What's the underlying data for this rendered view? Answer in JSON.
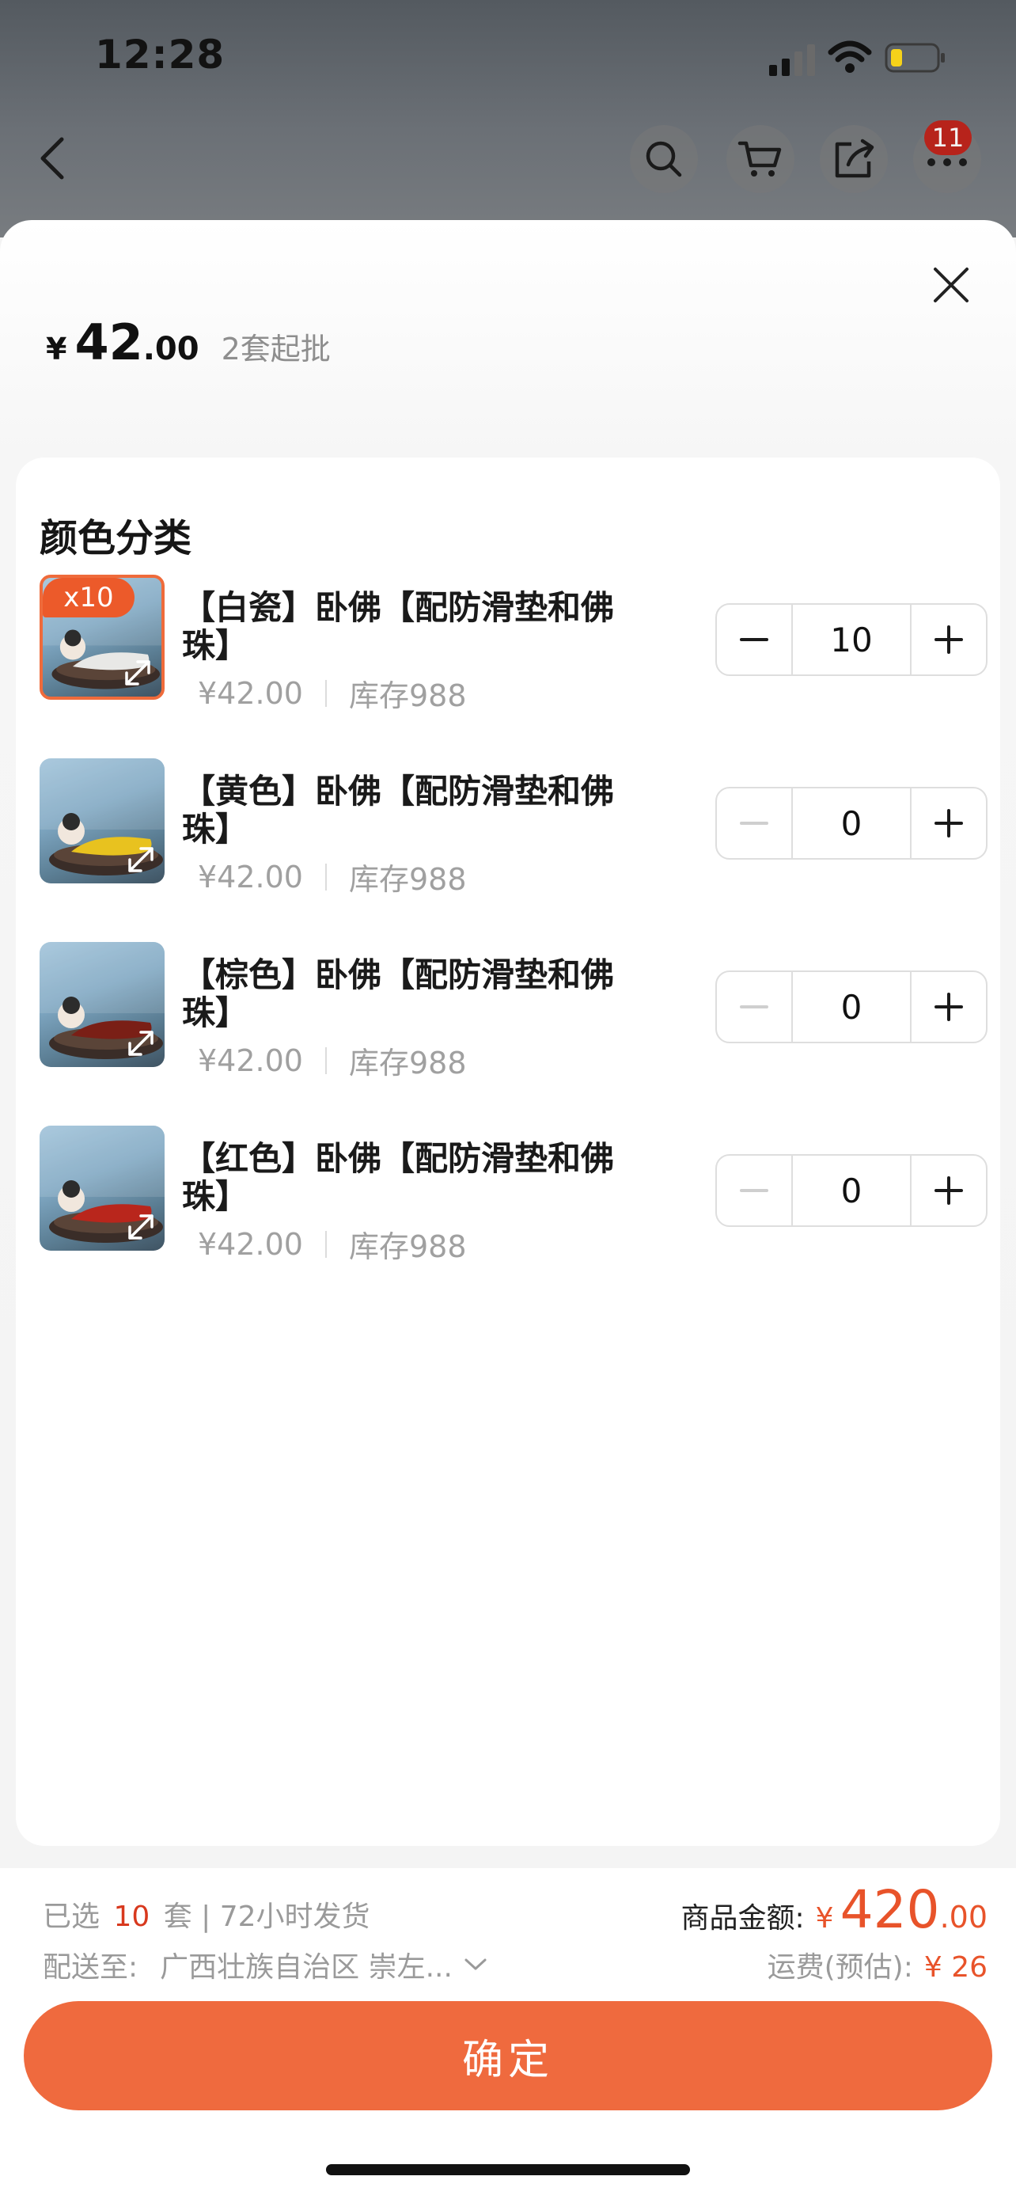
{
  "status_bar": {
    "time": "12:28"
  },
  "header": {
    "cart_badge": "11"
  },
  "sheet": {
    "price": {
      "currency": "¥",
      "integer": "42",
      "decimal": ".00",
      "min_order": "2套起批"
    },
    "section_title": "颜色分类",
    "items": [
      {
        "name": "【白瓷】卧佛【配防滑垫和佛珠】",
        "price": "¥42.00",
        "stock": "库存988",
        "qty": "10",
        "badge": "x10",
        "robe_color": "#e8e8e6"
      },
      {
        "name": "【黄色】卧佛【配防滑垫和佛珠】",
        "price": "¥42.00",
        "stock": "库存988",
        "qty": "0",
        "badge": "",
        "robe_color": "#e8c21f"
      },
      {
        "name": "【棕色】卧佛【配防滑垫和佛珠】",
        "price": "¥42.00",
        "stock": "库存988",
        "qty": "0",
        "badge": "",
        "robe_color": "#7a1f16"
      },
      {
        "name": "【红色】卧佛【配防滑垫和佛珠】",
        "price": "¥42.00",
        "stock": "库存988",
        "qty": "0",
        "badge": "",
        "robe_color": "#b9261c"
      }
    ]
  },
  "footer": {
    "selected_prefix": "已选",
    "selected_count": "10",
    "selected_suffix": "套 | 72小时发货",
    "ship_label": "配送至:",
    "ship_address": "广西壮族自治区 崇左...",
    "total_label": "商品金额:",
    "total_currency": "¥",
    "total_integer": "420",
    "total_decimal": ".00",
    "freight_label": "运费(预估):",
    "freight_value": "¥ 26",
    "confirm_label": "确定"
  },
  "colors": {
    "accent": "#ef6a3e",
    "price_red": "#e8532a",
    "badge_red": "#b7231b"
  }
}
